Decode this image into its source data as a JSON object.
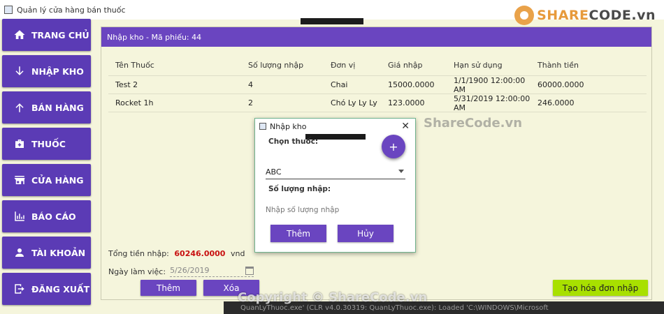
{
  "window": {
    "title": "Quản lý cửa hàng bán thuốc"
  },
  "brand": {
    "name_part1": "SHARE",
    "name_part2": "CODE.vn"
  },
  "sidebar": {
    "items": [
      {
        "label": "TRANG CHỦ",
        "icon": "home-icon"
      },
      {
        "label": "NHẬP KHO",
        "icon": "arrow-down-icon"
      },
      {
        "label": "BÁN HÀNG",
        "icon": "arrow-up-icon"
      },
      {
        "label": "THUỐC",
        "icon": "medkit-icon"
      },
      {
        "label": "CỬA HÀNG",
        "icon": "store-icon"
      },
      {
        "label": "BÁO CÁO",
        "icon": "chart-icon"
      },
      {
        "label": "TÀI KHOẢN",
        "icon": "user-icon"
      },
      {
        "label": "ĐĂNG XUẤT",
        "icon": "logout-icon"
      }
    ]
  },
  "panel": {
    "header": "Nhập kho - Mã phiếu: 44",
    "columns": [
      "Tên Thuốc",
      "Số lượng nhập",
      "Đơn vị",
      "Giá nhập",
      "Hạn sử dụng",
      "Thành tiền"
    ],
    "rows": [
      [
        "Test 2",
        "4",
        "Chai",
        "15000.0000",
        "1/1/1900 12:00:00 AM",
        "60000.0000"
      ],
      [
        "Rocket 1h",
        "2",
        "Chó Ly Ly Ly",
        "123.0000",
        "5/31/2019 12:00:00 AM",
        "246.0000"
      ]
    ],
    "total_label": "Tổng tiền nhập:",
    "total_value": "60246.0000",
    "total_unit": "vnd",
    "date_label": "Ngày làm việc:",
    "date_value": "5/26/2019",
    "add_button": "Thêm",
    "delete_button": "Xóa",
    "invoice_button": "Tạo hóa đơn nhập"
  },
  "dialog": {
    "title": "Nhập kho",
    "drug_label": "Chọn thuốc:",
    "fab_label": "+",
    "selected_drug": "ABC",
    "qty_label": "Số lượng nhập:",
    "qty_placeholder": "Nhập số lượng nhập",
    "add_button": "Thêm",
    "cancel_button": "Hủy"
  },
  "watermarks": {
    "center": "ShareCode.vn",
    "copyright": "Copyright © ShareCode.vn"
  },
  "taskbar": {
    "text": "QuanLyThuoc.exe' (CLR v4.0.30319: QuanLyThuoc.exe): Loaded 'C:\\WINDOWS\\Microsoft"
  },
  "colors": {
    "accent": "#5b3bb5",
    "header": "#6a45c0",
    "invoice": "#a8e000",
    "total": "#c81010"
  }
}
